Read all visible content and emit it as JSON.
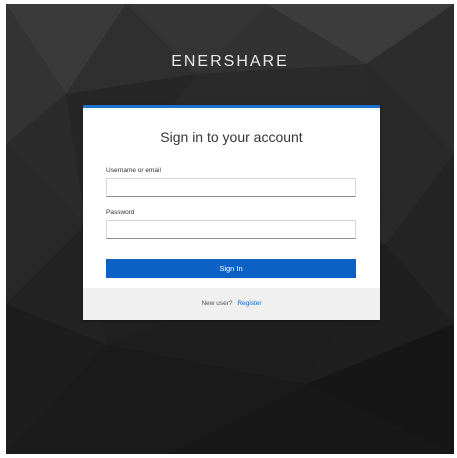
{
  "brand": {
    "name": "ENERSHARE"
  },
  "login": {
    "title": "Sign in to your account",
    "username_label": "Username or email",
    "username_value": "",
    "password_label": "Password",
    "password_value": "",
    "submit_label": "Sign In",
    "register_prompt": "New user?",
    "register_link": "Register"
  },
  "colors": {
    "accent": "#1f6fd1",
    "button": "#0c62c4",
    "link": "#0066cc",
    "background": "#2a2a2a"
  }
}
